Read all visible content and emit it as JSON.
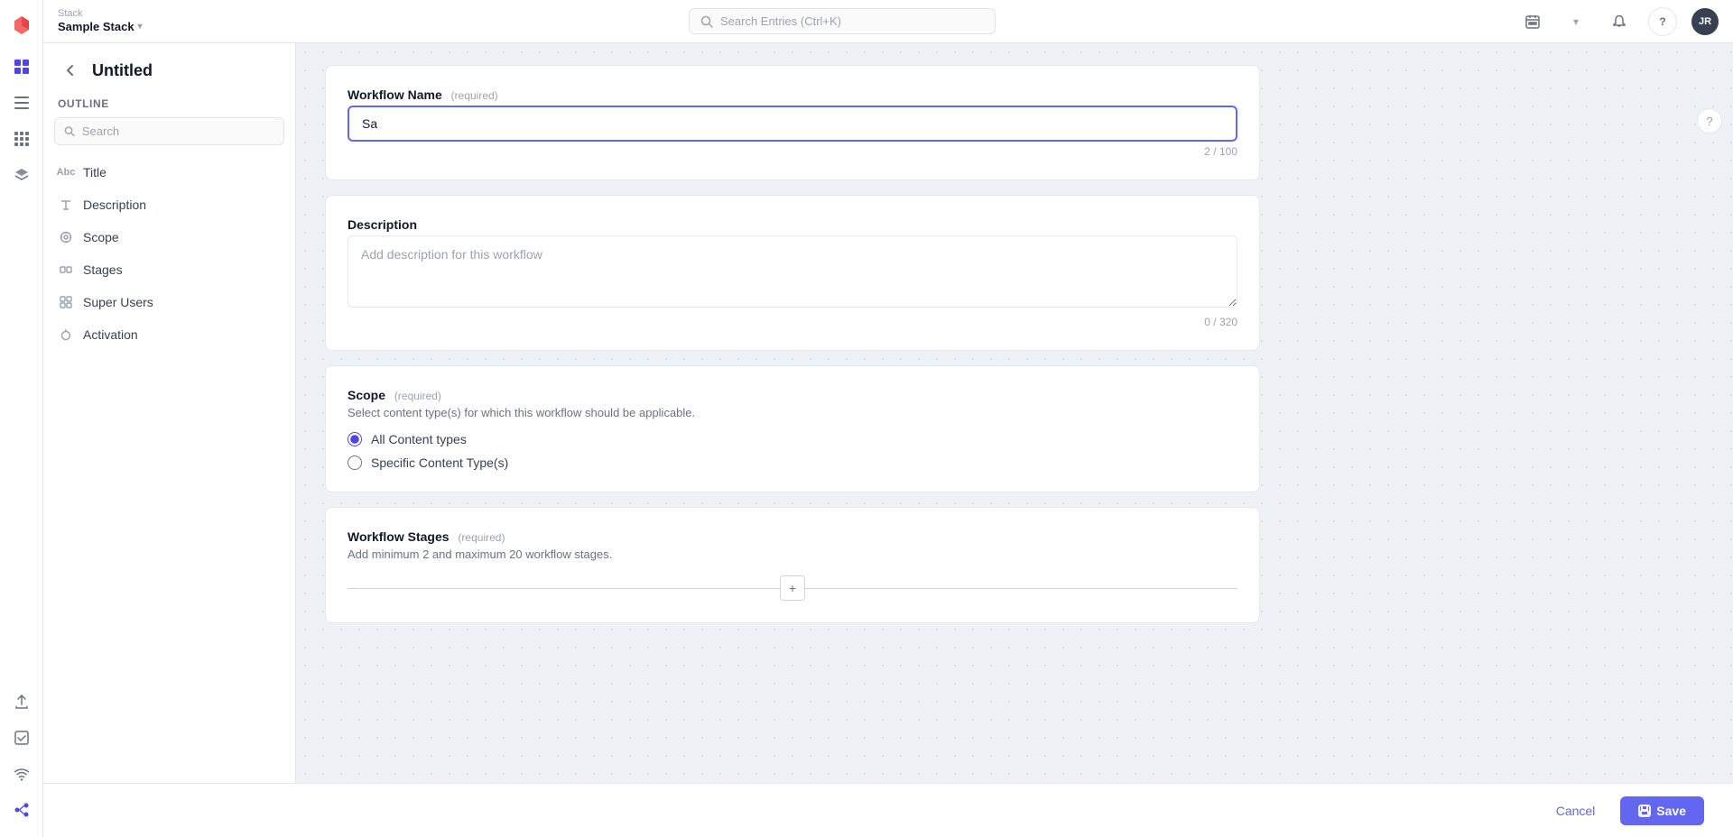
{
  "app": {
    "stack_label": "Stack",
    "stack_name": "Sample Stack",
    "search_placeholder": "Search Entries (Ctrl+K)",
    "user_avatar": "JR"
  },
  "topbar": {
    "calendar_icon": "📅",
    "dropdown_icon": "▾",
    "bell_icon": "🔔",
    "help_icon": "?",
    "chevron_down": "▾"
  },
  "sidebar": {
    "back_label": "←",
    "title": "Untitled",
    "outline_label": "Outline",
    "search_placeholder": "Search",
    "nav_items": [
      {
        "id": "title",
        "label": "Title",
        "icon": "Abc"
      },
      {
        "id": "description",
        "label": "Description",
        "icon": "T"
      },
      {
        "id": "scope",
        "label": "Scope",
        "icon": "⊙"
      },
      {
        "id": "stages",
        "label": "Stages",
        "icon": "⚙"
      },
      {
        "id": "superusers",
        "label": "Super Users",
        "icon": "⊞"
      },
      {
        "id": "activation",
        "label": "Activation",
        "icon": "⏻"
      }
    ]
  },
  "form": {
    "workflow_name_section": {
      "title": "Workflow Name",
      "required_label": "(required)",
      "value": "Sa",
      "char_count": "2 / 100"
    },
    "description_section": {
      "title": "Description",
      "placeholder": "Add description for this workflow",
      "char_count": "0 / 320"
    },
    "scope_section": {
      "title": "Scope",
      "required_label": "(required)",
      "subtitle": "Select content type(s) for which this workflow should be applicable.",
      "radio_options": [
        {
          "id": "all",
          "label": "All Content types",
          "checked": true
        },
        {
          "id": "specific",
          "label": "Specific Content Type(s)",
          "checked": false
        }
      ]
    },
    "stages_section": {
      "title": "Workflow Stages",
      "required_label": "(required)",
      "subtitle": "Add minimum 2 and maximum 20 workflow stages."
    }
  },
  "actions": {
    "cancel_label": "Cancel",
    "save_label": "Save"
  }
}
